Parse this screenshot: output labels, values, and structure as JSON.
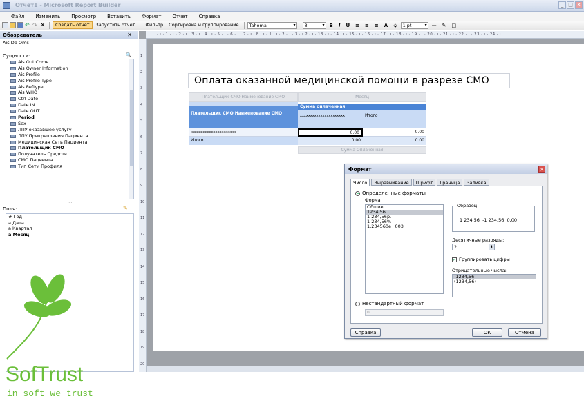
{
  "window": {
    "title": "Отчет1 - Microsoft Report Builder",
    "controls": [
      "_",
      "□",
      "✕"
    ]
  },
  "menu": [
    "Файл",
    "Изменить",
    "Просмотр",
    "Вставить",
    "Формат",
    "Отчет",
    "Справка"
  ],
  "toolbar": {
    "create_report": "Создать отчет",
    "run_report": "Запустить отчет",
    "filter": "Фильтр",
    "sort_group": "Сортировка и группирование",
    "font": "Tahoma",
    "size": "8",
    "bold": "B",
    "italic": "I",
    "underline": "U",
    "line_width": "1 pt"
  },
  "explorer": {
    "title": "Обозреватель",
    "close": "✕",
    "model": "Ais Db Oms",
    "entities_label": "Сущности:",
    "entities": [
      "Ais Out Come",
      "Ais Owner Information",
      "Ais Profile",
      "Ais Profile Type",
      "Ais Reftype",
      "Ais WHO",
      "Ctrl Date",
      "Date IN",
      "Date OUT",
      "Period",
      "Sex",
      "ЛПУ оказавшее услугу",
      "ЛПУ Прикрепления Пациента",
      "Медицинская Сеть Пациента",
      "Плательщик СМО",
      "Получатель Средств",
      "СМО Пациента",
      "Тип Сети Профиля"
    ],
    "splitter": "....",
    "fields_label": "Поля:",
    "fields": [
      "# Год",
      "a Дата",
      "a Квартал",
      "a Месяц"
    ]
  },
  "ruler": {
    "top": "· ı · 1 · ı · 2 · ı · 3 · ı · 4 · ı · 5 · ı · 6 · ı · 7 · ı · 8   · ı · 1 · ı · 2 · ı · 3 · ı  2 · ı · 13 · ı · 14 · ı · 15 · ı · 16 · ı · 17 · ı · 18 · ı · 19 · ı · 20 · ı · 21 · ı · 22 · ı · 23 · ı · 24 · ı",
    "left": [
      "1",
      "2",
      "3",
      "4",
      "5",
      "6",
      "7",
      "8",
      "9",
      "10",
      "11",
      "12",
      "13",
      "14",
      "15",
      "16",
      "17",
      "18",
      "19",
      "20"
    ]
  },
  "report": {
    "title": "Оплата оказанной медицинской помощи в разрезе СМО",
    "group_header_left": "Плательщик СМО Наименование СМО",
    "group_header_right": "Месяц",
    "sum_header": "Сумма оплаченная",
    "row_header": "Плательщик СМО Наименование СМО",
    "month_placeholder": "xxxxxxxxxxxxxxxxxxxxxx",
    "total": "Итого",
    "data_placeholder": "xxxxxxxxxxxxxxxxxxxxxx",
    "val1": "0.00",
    "val2": "0.00",
    "val3": "0.00",
    "val4": "0.00",
    "footer_label": "Сумма Оплаченная"
  },
  "dialog": {
    "title": "Формат",
    "tabs": [
      "Число",
      "Выравнивание",
      "Шрифт",
      "Граница",
      "Заливка"
    ],
    "defined_formats": "Определенные форматы",
    "format_label": "Формат:",
    "formats": [
      "Общие",
      "1234,56",
      "1 234,56р.",
      "1 234,56%",
      "1,234560e+003"
    ],
    "selected_format": "1234,56",
    "sample_label": "Образец",
    "sample_text": "1 234,56  -1 234,56  0,00",
    "decimals_label": "Десятичные разряды:",
    "decimals_value": "2",
    "group_digits": "Группировать цифры",
    "negative_label": "Отрицательные числа:",
    "negatives": [
      "-1234,56",
      "(1234,56)"
    ],
    "custom_format": "Нестандартный формат",
    "custom_value": "n",
    "help": "Справка",
    "ok": "ОК",
    "cancel": "Отмена"
  },
  "logo": {
    "brand": "SofTrust",
    "tagline": "in soft we trust",
    "color": "#6bbf3a"
  }
}
